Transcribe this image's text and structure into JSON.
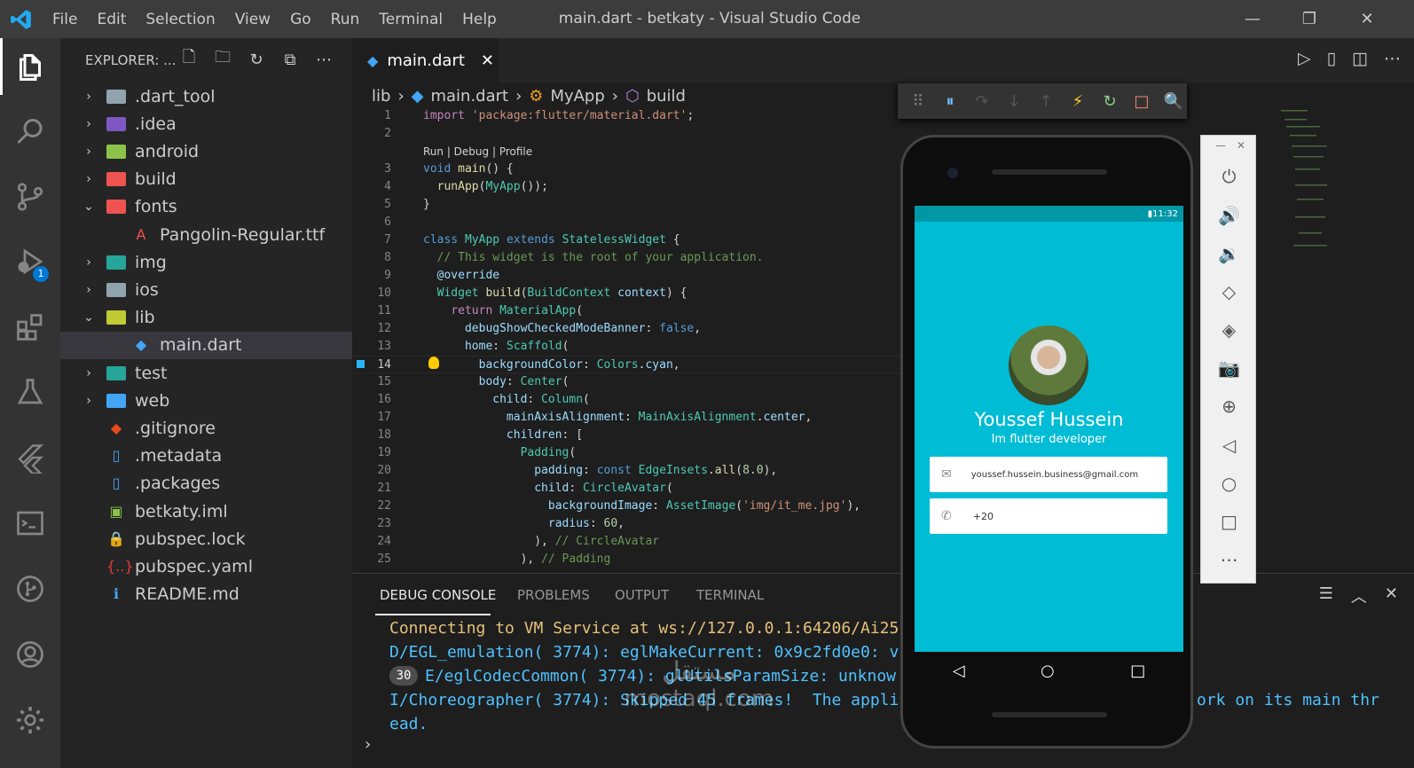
{
  "window": {
    "title": "main.dart - betkaty - Visual Studio Code"
  },
  "menu": [
    "File",
    "Edit",
    "Selection",
    "View",
    "Go",
    "Run",
    "Terminal",
    "Help"
  ],
  "activity": {
    "debug_badge": "1"
  },
  "explorer": {
    "header": "EXPLORER: ...",
    "items": [
      {
        "label": ".dart_tool",
        "type": "folder",
        "color": "#90a4ae",
        "chev": "›"
      },
      {
        "label": ".idea",
        "type": "folder",
        "color": "#7e57c2",
        "chev": "›"
      },
      {
        "label": "android",
        "type": "folder",
        "color": "#8bc34a",
        "chev": "›"
      },
      {
        "label": "build",
        "type": "folder",
        "color": "#ef5350",
        "chev": "›"
      },
      {
        "label": "fonts",
        "type": "folder",
        "color": "#ef5350",
        "chev": "⌄"
      },
      {
        "label": "Pangolin-Regular.ttf",
        "type": "file",
        "color": "#ef5350",
        "glyph": "A"
      },
      {
        "label": "img",
        "type": "folder",
        "color": "#26a69a",
        "chev": "›"
      },
      {
        "label": "ios",
        "type": "folder",
        "color": "#90a4ae",
        "chev": "›"
      },
      {
        "label": "lib",
        "type": "folder",
        "color": "#c0ca33",
        "chev": "⌄"
      },
      {
        "label": "main.dart",
        "type": "file",
        "color": "#42a5f5",
        "glyph": "◆"
      },
      {
        "label": "test",
        "type": "folder",
        "color": "#26a69a",
        "chev": "›"
      },
      {
        "label": "web",
        "type": "folder",
        "color": "#42a5f5",
        "chev": "›"
      },
      {
        "label": ".gitignore",
        "type": "file",
        "color": "#e64a19",
        "glyph": "◆"
      },
      {
        "label": ".metadata",
        "type": "file",
        "color": "#42a5f5",
        "glyph": "▯"
      },
      {
        "label": ".packages",
        "type": "file",
        "color": "#42a5f5",
        "glyph": "▯"
      },
      {
        "label": "betkaty.iml",
        "type": "file",
        "color": "#8bc34a",
        "glyph": "▣"
      },
      {
        "label": "pubspec.lock",
        "type": "file",
        "color": "#fbc02d",
        "glyph": "🔒"
      },
      {
        "label": "pubspec.yaml",
        "type": "file",
        "color": "#e53935",
        "glyph": "{..}"
      },
      {
        "label": "README.md",
        "type": "file",
        "color": "#42a5f5",
        "glyph": "ℹ"
      }
    ]
  },
  "editor": {
    "tab": "main.dart",
    "breadcrumb": [
      "lib",
      "main.dart",
      "MyApp",
      "build"
    ],
    "codelens": "Run | Debug | Profile"
  },
  "panel": {
    "tabs": [
      "DEBUG CONSOLE",
      "PROBLEMS",
      "OUTPUT",
      "TERMINAL"
    ],
    "lines": [
      {
        "text": "Connecting to VM Service at ws://127.0.0.1:64206/Ai25",
        "color": "#e5c07b"
      },
      {
        "text": "D/EGL_emulation( 3774): eglMakeCurrent: 0x9c2fd0e0: v",
        "color": "#4fc1ff"
      },
      {
        "text": "E/eglCodecCommon( 3774): glUtilsParamSize: unknow",
        "color": "#4fc1ff",
        "count": "30"
      },
      {
        "text": "I/Choreographer( 3774): Skipped 45 frames!  The appli",
        "color": "#4fc1ff",
        "tail": "ork on its main thr"
      },
      {
        "text": "ead.",
        "color": "#4fc1ff"
      }
    ]
  },
  "phone": {
    "time": "11:32",
    "name": "Youssef Hussein",
    "subtitle": "Im flutter developer",
    "email": "youssef.hussein.business@gmail.com",
    "phone": "+20"
  },
  "watermark": {
    "line1": "مستقل",
    "line2": "mostaql.com"
  },
  "colors": {
    "cyan": "#00bcd4",
    "accent": "#007acc"
  }
}
